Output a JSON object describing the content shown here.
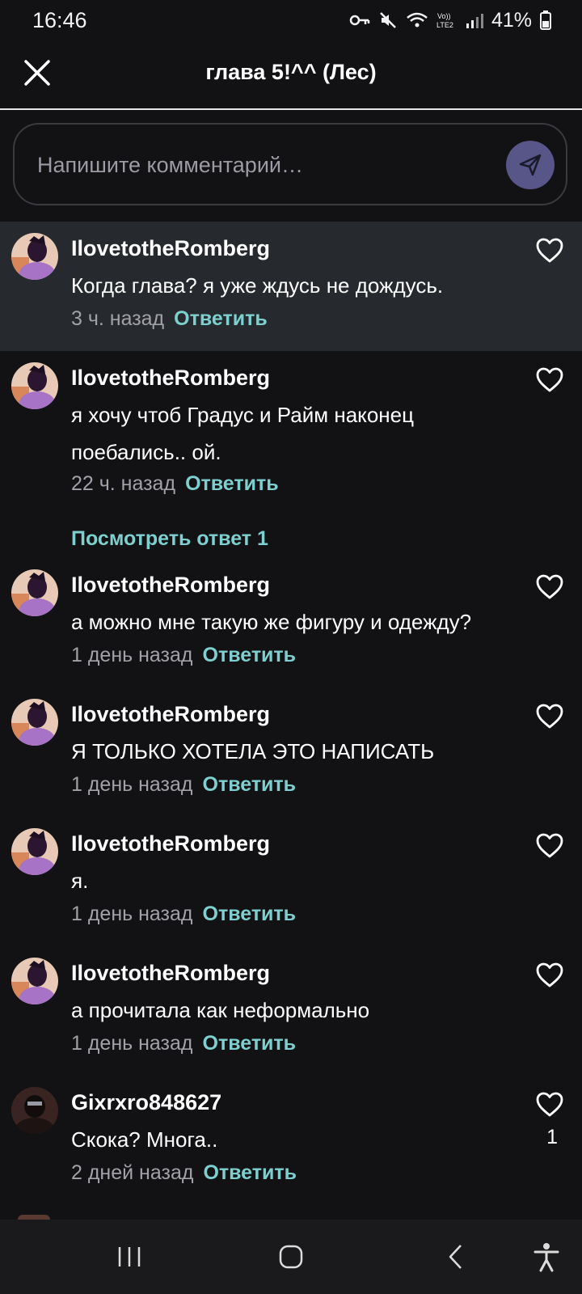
{
  "status_bar": {
    "time": "16:46",
    "battery": "41%"
  },
  "header": {
    "title": "глава 5!^^ (Лес)"
  },
  "comment_input": {
    "placeholder": "Напишите комментарий…"
  },
  "comments": [
    {
      "username": "IlovetotheRomberg",
      "text": "Когда глава? я уже ждусь не дождусь.",
      "time": "3 ч. назад",
      "reply": "Ответить",
      "highlighted": true
    },
    {
      "username": "IlovetotheRomberg",
      "text": "я хочу чтоб Градус и Райм наконец поебались.. ой.",
      "time": "22 ч. назад",
      "reply": "Ответить",
      "view_replies": "Посмотреть ответ 1"
    },
    {
      "username": "IlovetotheRomberg",
      "text": "а можно мне такую же фигуру и одежду?",
      "time": "1 день назад",
      "reply": "Ответить"
    },
    {
      "username": "IlovetotheRomberg",
      "text": "Я ТОЛЬКО ХОТЕЛА ЭТО НАПИСАТЬ",
      "time": "1 день назад",
      "reply": "Ответить"
    },
    {
      "username": "IlovetotheRomberg",
      "text": "я.",
      "time": "1 день назад",
      "reply": "Ответить"
    },
    {
      "username": "IlovetotheRomberg",
      "text": "а прочитала как неформально",
      "time": "1 день назад",
      "reply": "Ответить"
    },
    {
      "username": "Gixrxro848627",
      "text": "Скока? Многа..",
      "time": "2 дней назад",
      "reply": "Ответить",
      "likes": "1"
    }
  ],
  "icons": {
    "close": "close-icon",
    "send": "send-icon",
    "like": "heart-outline-icon",
    "nav": [
      "recent-apps-icon",
      "home-icon",
      "back-icon",
      "accessibility-icon"
    ]
  },
  "colors": {
    "background": "#121114",
    "highlight": "#26292d",
    "accent_link": "#7dd0cf",
    "send_button": "#585589",
    "muted_text": "#a3a1a8"
  }
}
